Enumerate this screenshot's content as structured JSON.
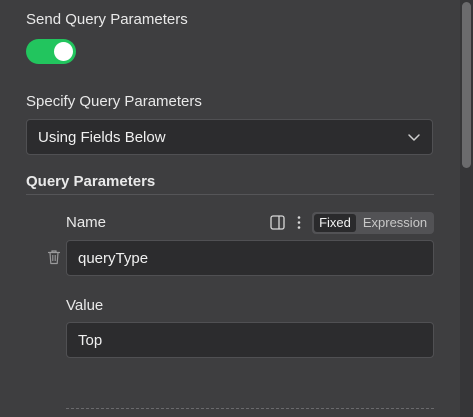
{
  "send_query": {
    "label": "Send Query Parameters",
    "toggle_on": true,
    "toggle_color": "#22c55e"
  },
  "specify": {
    "label": "Specify Query Parameters",
    "selected": "Using Fields Below"
  },
  "query_params": {
    "heading": "Query Parameters",
    "name_label": "Name",
    "mode_fixed": "Fixed",
    "mode_expression": "Expression",
    "name_value": "queryType",
    "value_label": "Value",
    "value_value": "Top"
  },
  "icons": {
    "chevron": "chevron-down-icon",
    "trash": "trash-icon",
    "panel": "side-panel-icon",
    "dots": "more-vertical-icon"
  }
}
